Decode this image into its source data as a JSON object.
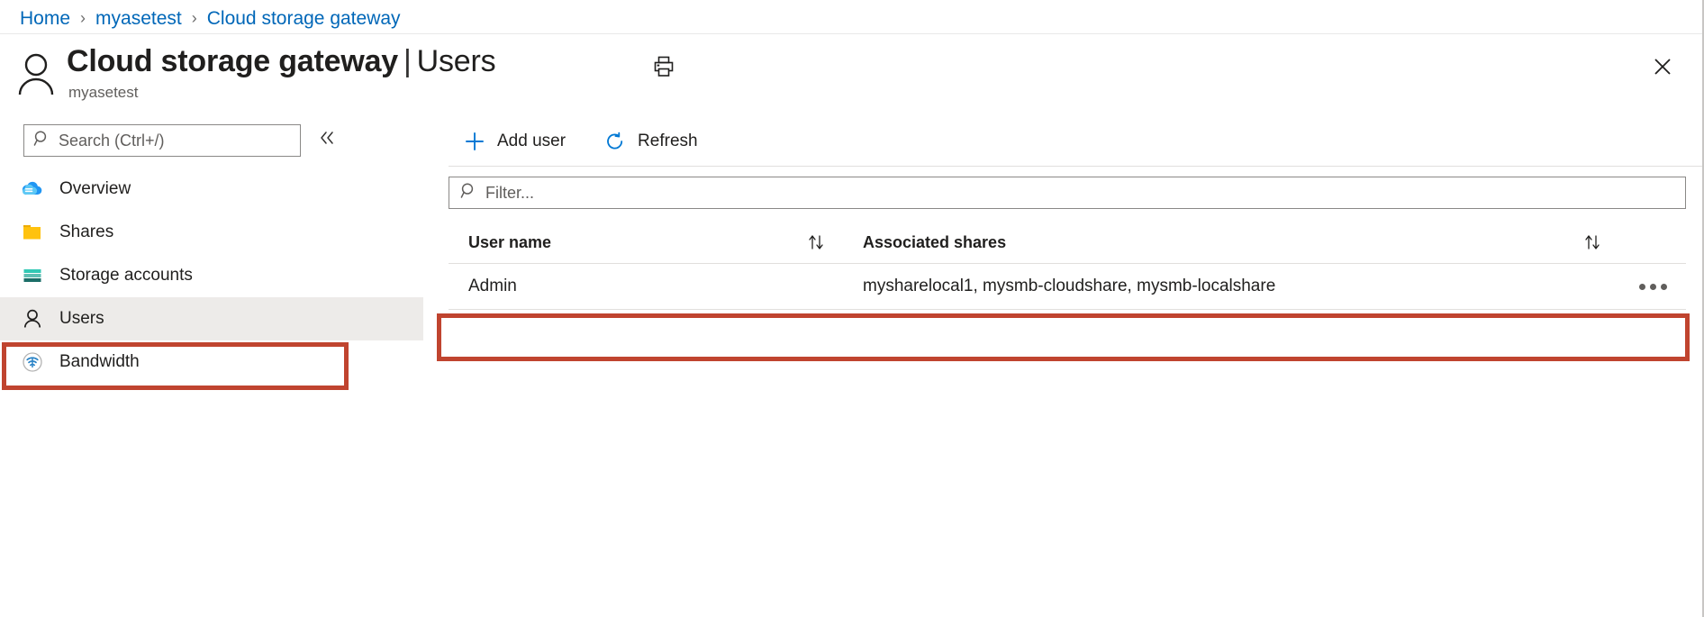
{
  "breadcrumb": {
    "items": [
      {
        "label": "Home"
      },
      {
        "label": "myasetest"
      },
      {
        "label": "Cloud storage gateway"
      }
    ],
    "separator": "›"
  },
  "header": {
    "title": "Cloud storage gateway",
    "title_separator": "|",
    "title_section": "Users",
    "subtitle": "myasetest",
    "print_icon": "print-icon",
    "close_icon": "close-icon",
    "avatar_icon": "user-avatar-icon"
  },
  "sidebar": {
    "search": {
      "placeholder": "Search (Ctrl+/)",
      "icon": "search-icon"
    },
    "collapse_icon": "chevron-double-left-icon",
    "items": [
      {
        "label": "Overview",
        "icon": "cloud-icon",
        "selected": false
      },
      {
        "label": "Shares",
        "icon": "folder-icon",
        "selected": false
      },
      {
        "label": "Storage accounts",
        "icon": "storage-account-icon",
        "selected": false
      },
      {
        "label": "Users",
        "icon": "user-icon",
        "selected": true
      },
      {
        "label": "Bandwidth",
        "icon": "bandwidth-icon",
        "selected": false
      }
    ]
  },
  "toolbar": {
    "add_user_label": "Add user",
    "add_user_icon": "plus-icon",
    "refresh_label": "Refresh",
    "refresh_icon": "refresh-icon"
  },
  "filter": {
    "placeholder": "Filter...",
    "icon": "search-icon"
  },
  "table": {
    "columns": [
      {
        "label": "User name",
        "sort_icon": "sort-updown-icon"
      },
      {
        "label": "Associated shares",
        "sort_icon": "sort-updown-icon"
      }
    ],
    "rows": [
      {
        "user_name": "Admin",
        "associated_shares": "mysharelocal1, mysmb-cloudshare, mysmb-localshare",
        "actions_icon": "more-options-icon"
      }
    ]
  },
  "annotations": {
    "highlight_color": "#c0442f",
    "targets": [
      "sidebar-item-users",
      "table-row-admin"
    ]
  },
  "colors": {
    "link": "#0067b8",
    "accent": "#0078d4",
    "selected_row_bg": "#edebe9",
    "annotation_red": "#c0442f"
  }
}
